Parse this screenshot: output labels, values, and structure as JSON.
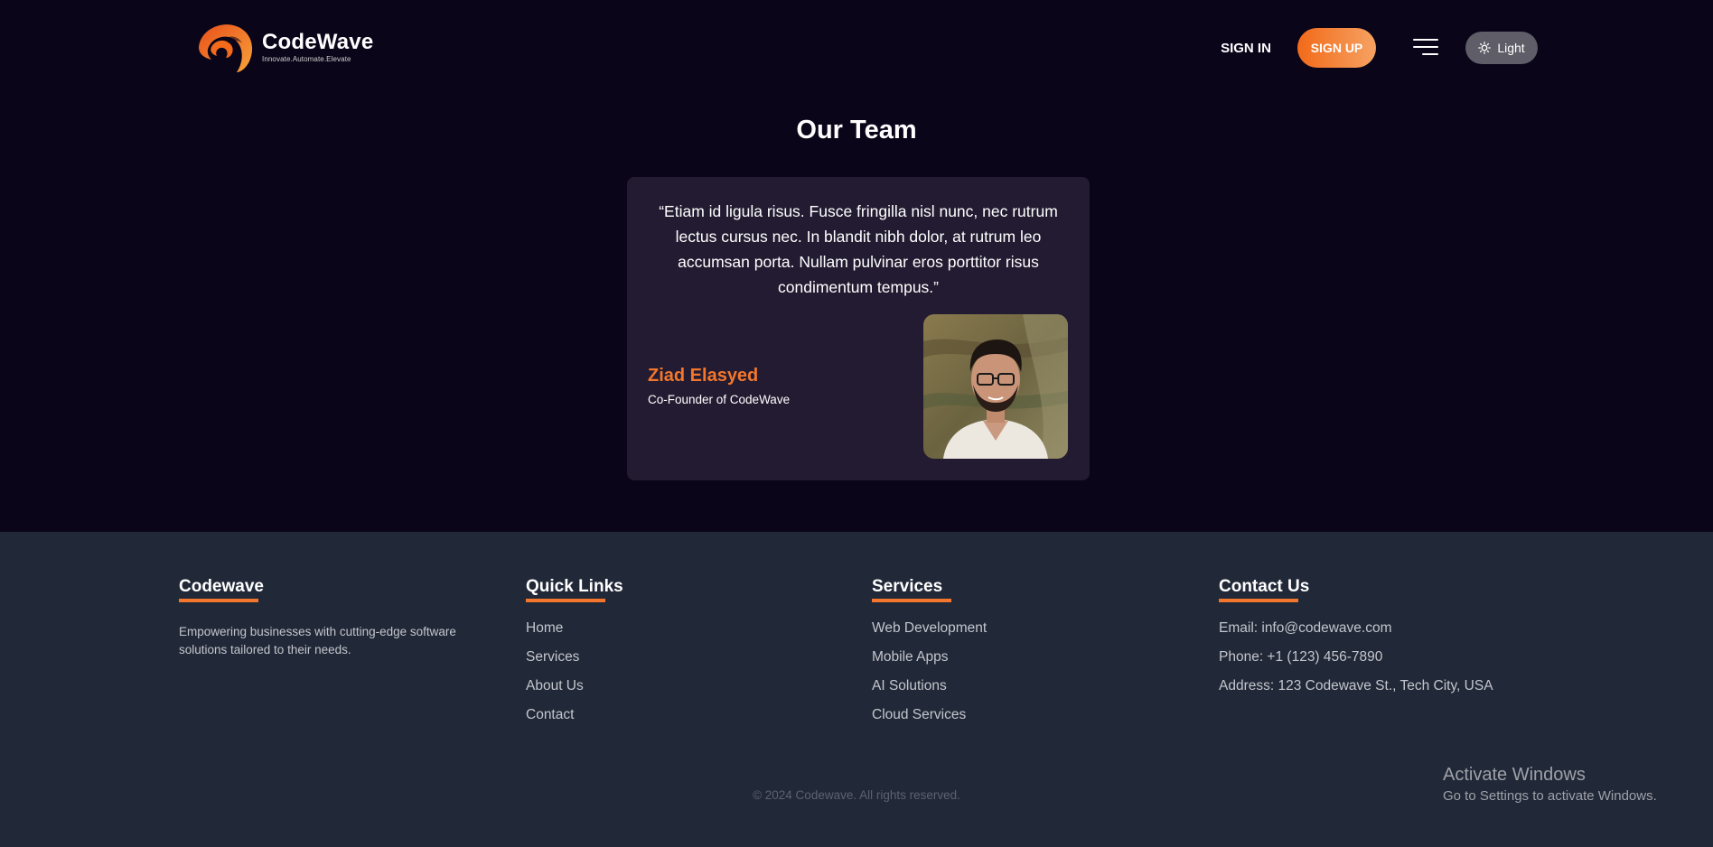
{
  "header": {
    "logo_name": "CodeWave",
    "logo_tagline": "Innovate.Automate.Elevate",
    "signin_label": "SIGN IN",
    "signup_label": "SIGN UP",
    "theme_label": "Light",
    "menu_icon": "hamburger-menu-icon",
    "theme_icon": "sun-icon"
  },
  "team": {
    "title": "Our Team",
    "testimonial": "“Etiam id ligula risus. Fusce fringilla nisl nunc, nec rutrum lectus cursus nec. In blandit nibh dolor, at rutrum leo accumsan porta. Nullam pulvinar eros porttitor risus condimentum tempus.”",
    "member_name": "Ziad Elasyed",
    "member_role": "Co-Founder of CodeWave"
  },
  "footer": {
    "brand": {
      "heading": "Codewave",
      "description": "Empowering businesses with cutting-edge software solutions tailored to their needs."
    },
    "quick_links": {
      "heading": "Quick Links",
      "items": [
        "Home",
        "Services",
        "About Us",
        "Contact"
      ]
    },
    "services": {
      "heading": "Services",
      "items": [
        "Web Development",
        "Mobile Apps",
        "AI Solutions",
        "Cloud Services"
      ]
    },
    "contact": {
      "heading": "Contact Us",
      "items": [
        "Email: info@codewave.com",
        "Phone: +1 (123) 456-7890",
        "Address: 123 Codewave St., Tech City, USA"
      ]
    },
    "copyright": "© 2024 Codewave. All rights reserved."
  },
  "os_overlay": {
    "title": "Activate Windows",
    "subtitle": "Go to Settings to activate Windows."
  },
  "colors": {
    "accent": "#f2772c",
    "page_background": "#0a0519",
    "card_background": "#231b31",
    "footer_background": "#212837"
  }
}
